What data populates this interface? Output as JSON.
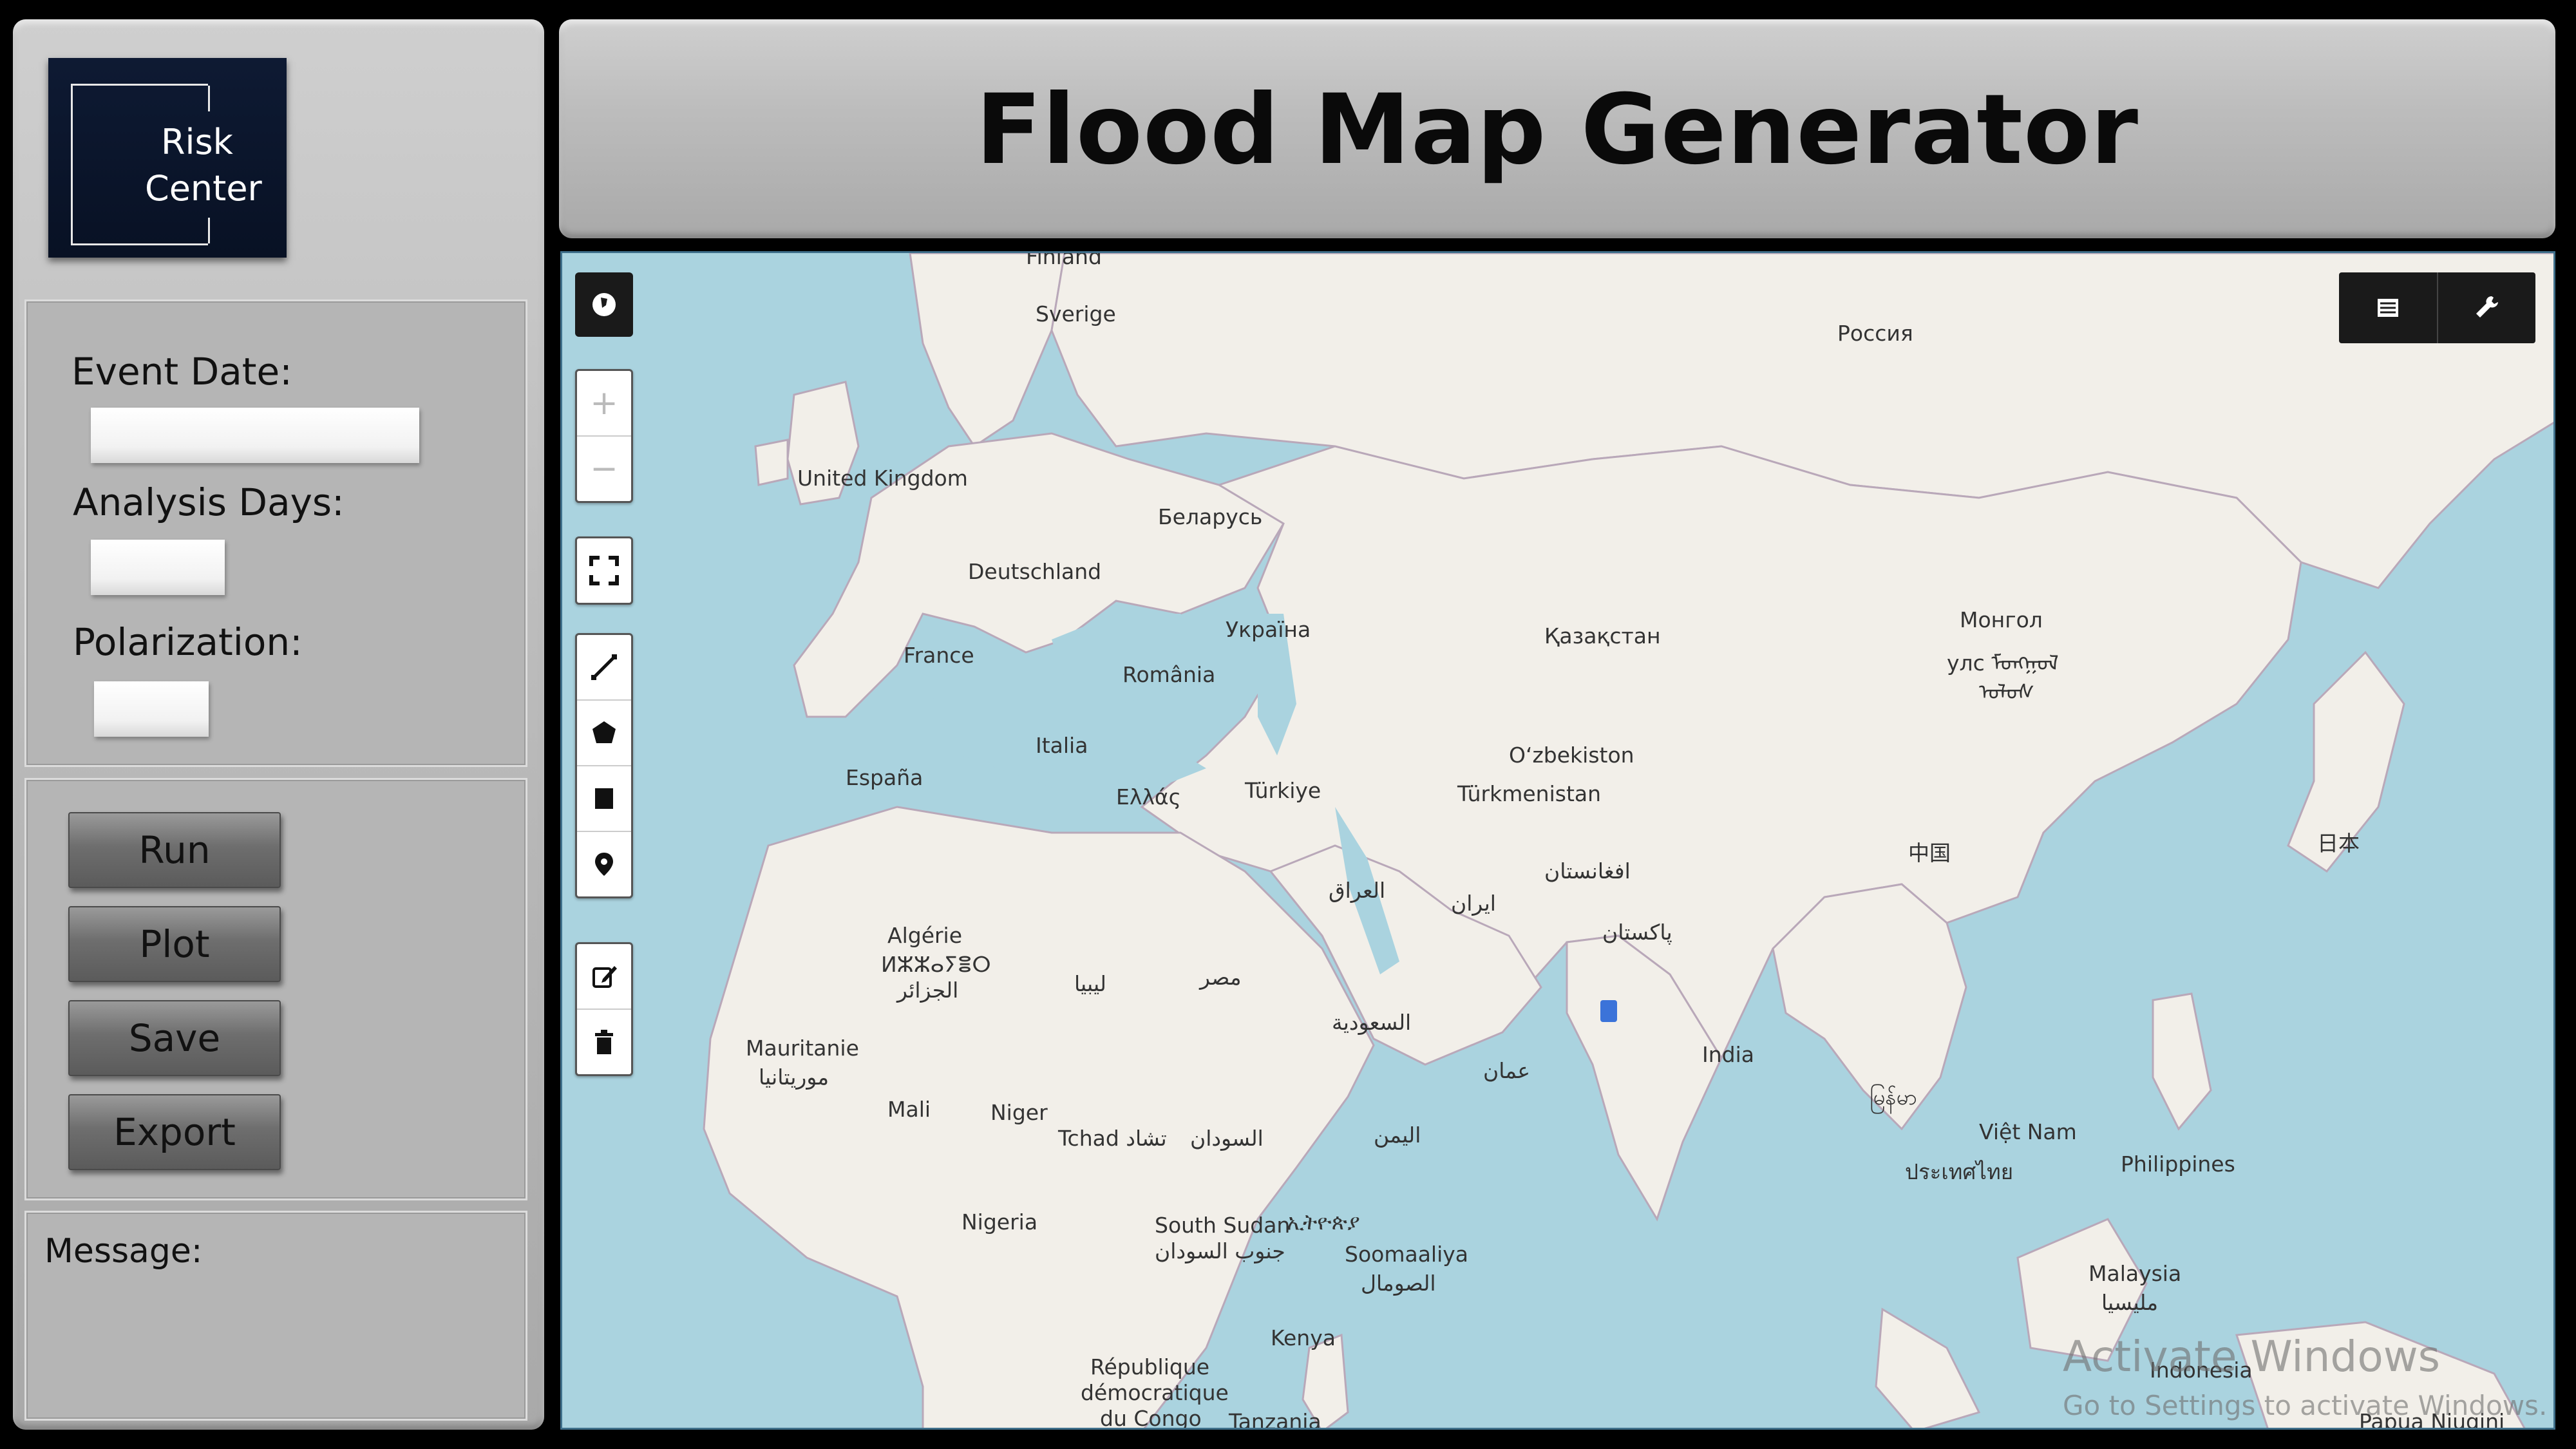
{
  "app": {
    "title": "Flood Map Generator",
    "logo_line1": "Risk",
    "logo_line2": "Center"
  },
  "form": {
    "event_date_label": "Event Date:",
    "event_date_value": "",
    "analysis_days_label": "Analysis Days:",
    "analysis_days_value": "",
    "polarization_label": "Polarization:",
    "polarization_value": ""
  },
  "buttons": {
    "run": "Run",
    "plot": "Plot",
    "save": "Save",
    "export": "Export"
  },
  "message": {
    "label": "Message:",
    "text": ""
  },
  "map": {
    "zoom_in": "+",
    "zoom_out": "−",
    "labels": [
      "Finland",
      "Sverige",
      "Россия",
      "United Kingdom",
      "Беларусь",
      "Deutschland",
      "Україна",
      "Қазақстан",
      "Монгол",
      "улс ᠮᠣᠩᠭᠣᠯ",
      "ᠤᠯᠤᠰ",
      "France",
      "România",
      "Italia",
      "España",
      "Ελλάς",
      "Türkiye",
      "O‘zbekiston",
      "Türkmenistan",
      "العراق",
      "ایران",
      "افغانستان",
      "پاکستان",
      "中国",
      "日本",
      "Algérie",
      "ⵍⵣⵣⴰⵢⴻⵔ",
      "الجزائر",
      "ليبيا",
      "مصر",
      "السعودية",
      "عمان",
      "India",
      "Mauritanie",
      "موريتانيا",
      "Mali",
      "Niger",
      "Tchad تشاد",
      "السودان",
      "اليمن",
      "မြန်မာ",
      "Việt Nam",
      "ประเทศไทย",
      "Philippines",
      "Nigeria",
      "South Sudan",
      "ኢትዮጵያ",
      "جنوب السودان",
      "Soomaaliya",
      "الصومال",
      "Malaysia",
      "مليسيا",
      "Kenya",
      "République",
      "démocratique",
      "du Congo",
      "Tanzania",
      "Indonesia",
      "Papua Niugini"
    ]
  },
  "watermark": {
    "line1": "Activate Windows",
    "line2": "Go to Settings to activate Windows."
  },
  "colors": {
    "water": "#aad3df",
    "land": "#f2efe9",
    "logo_bg": "#0e1a33",
    "marker": "#3b73d9"
  },
  "icons": {
    "locate": "globe-icon",
    "fullscreen": "fullscreen-icon",
    "line": "draw-line-icon",
    "polygon": "draw-polygon-icon",
    "rectangle": "draw-rectangle-icon",
    "marker": "draw-marker-icon",
    "edit": "edit-icon",
    "delete": "trash-icon",
    "layers": "layers-icon",
    "settings": "wrench-icon"
  }
}
